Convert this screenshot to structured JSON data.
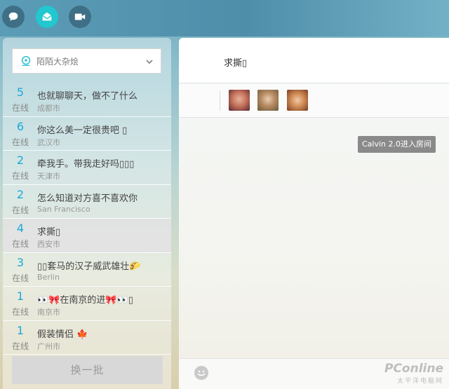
{
  "topbar": {
    "buttons": [
      {
        "icon": "chat-bubble-icon",
        "active": false
      },
      {
        "icon": "mail-open-icon",
        "active": true
      },
      {
        "icon": "video-camera-icon",
        "active": false
      }
    ]
  },
  "sidebar": {
    "dropdown": {
      "icon": "location-pin-icon",
      "label": "陌陌大杂烩"
    },
    "online_label": "在线",
    "rooms": [
      {
        "count": "5",
        "title": "也就聊聊天，做不了什么",
        "city": "成都市"
      },
      {
        "count": "6",
        "title": "你这么美一定很贵吧 ▯",
        "city": "武汉市"
      },
      {
        "count": "2",
        "title": "牵我手。带我走好吗▯▯▯",
        "city": "天津市"
      },
      {
        "count": "2",
        "title": "怎么知道对方喜不喜欢你",
        "city": "San Francisco"
      },
      {
        "count": "4",
        "title": "求撕▯",
        "city": "西安市",
        "active": true
      },
      {
        "count": "3",
        "title": "▯▯套马的汉子威武雄壮🌮",
        "city": "Berlin"
      },
      {
        "count": "1",
        "title": "👀🎀在南京的进🎀👀▯",
        "city": "南京市"
      },
      {
        "count": "1",
        "title": "假装情侣 🍁",
        "city": "广州市"
      }
    ],
    "refresh_label": "换一批"
  },
  "room": {
    "title": "求撕▯",
    "toast": "Calvin 2.0进入房间",
    "avatars": [
      "avatar-1",
      "avatar-2",
      "avatar-3"
    ]
  },
  "watermark": {
    "line1": "PConline",
    "line2": "太平洋电脑网"
  },
  "colors": {
    "accent": "#22c7cf",
    "count": "#1ba8d8"
  }
}
